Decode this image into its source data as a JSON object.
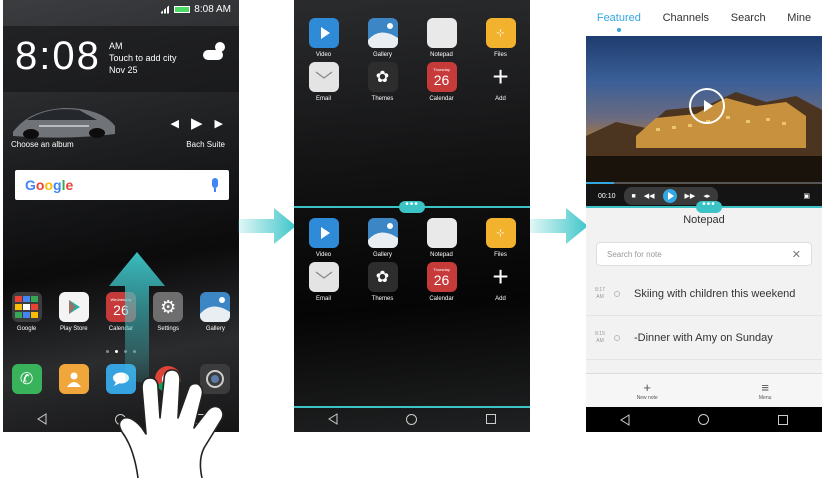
{
  "phone1": {
    "status_time": "8:08 AM",
    "clock": {
      "time": "8:08",
      "ampm": "AM",
      "city": "Touch to add city",
      "date": "Nov 25"
    },
    "music": {
      "album": "Choose an album",
      "track": "Bach Suite"
    },
    "search": {
      "brand": "Google"
    },
    "apps": [
      {
        "label": "Google",
        "color": "#3d3d3d"
      },
      {
        "label": "Play Store",
        "color": "#f4f4f4"
      },
      {
        "label": "Calendar",
        "color": "#c73a3a",
        "day": "26",
        "weekday": "Wednesday"
      },
      {
        "label": "Settings",
        "color": "#6e6e6e"
      },
      {
        "label": "Gallery",
        "color": "#3d86c6"
      }
    ],
    "dock": [
      {
        "name": "phone",
        "color": "#38b25b"
      },
      {
        "name": "contacts",
        "color": "#f0a63a"
      },
      {
        "name": "messages",
        "color": "#37a2e0"
      },
      {
        "name": "chrome",
        "color": "#ffffff"
      },
      {
        "name": "camera",
        "color": "#3b3b3b"
      }
    ]
  },
  "phone2": {
    "apps_row1": [
      {
        "label": "Video",
        "color": "#2f8ad8"
      },
      {
        "label": "Gallery",
        "color": "#3d86c6"
      },
      {
        "label": "Notepad",
        "color": "#e9e9e9"
      },
      {
        "label": "Files",
        "color": "#f2b22e"
      }
    ],
    "apps_row2": [
      {
        "label": "Email",
        "color": "#e4e4e4"
      },
      {
        "label": "Themes",
        "color": "#2d2d2d"
      },
      {
        "label": "Calendar",
        "color": "#c73a3a",
        "day": "26",
        "weekday": "Thursday"
      },
      {
        "label": "Add",
        "color": "transparent"
      }
    ]
  },
  "phone3": {
    "tabs": [
      "Featured",
      "Channels",
      "Search",
      "Mine"
    ],
    "video": {
      "elapsed": "00:10",
      "progress": 0.12
    },
    "notepad": {
      "title": "Notepad",
      "search_placeholder": "Search for note",
      "notes": [
        {
          "time": "8:17",
          "ampm": "AM",
          "text": "Skiing with children this weekend"
        },
        {
          "time": "8:15",
          "ampm": "AM",
          "text": "-Dinner with Amy on Sunday"
        }
      ],
      "tools": [
        {
          "glyph": "+",
          "label": "New note"
        },
        {
          "glyph": "≡",
          "label": "Menu"
        }
      ]
    }
  },
  "colors": {
    "accent": "#3cc3c6",
    "video_accent": "#34a7e2"
  }
}
